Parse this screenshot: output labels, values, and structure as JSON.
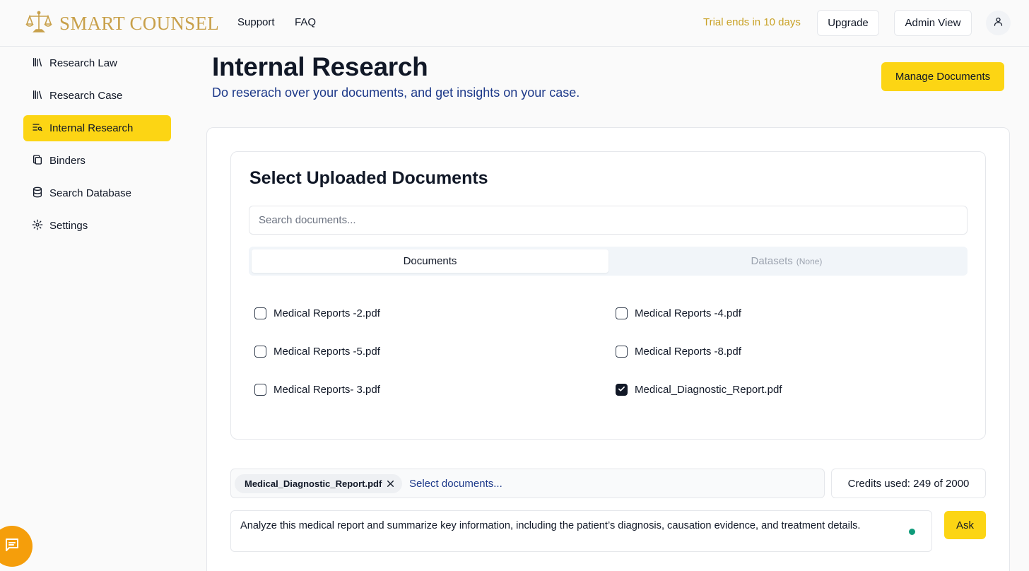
{
  "brand": {
    "name": "SMART COUNSEL",
    "logo_icon": "scales-of-justice-icon",
    "color": "#c8a04a"
  },
  "topnav": {
    "links": [
      "Support",
      "FAQ"
    ],
    "trial_text": "Trial ends in 10 days",
    "upgrade_label": "Upgrade",
    "admin_view_label": "Admin View",
    "user_icon": "user-icon"
  },
  "sidebar": {
    "items": [
      {
        "label": "Research Law",
        "icon": "library-icon",
        "active": false
      },
      {
        "label": "Research Case",
        "icon": "library-icon",
        "active": false
      },
      {
        "label": "Internal Research",
        "icon": "text-search-icon",
        "active": true
      },
      {
        "label": "Binders",
        "icon": "copy-icon",
        "active": false
      },
      {
        "label": "Search Database",
        "icon": "database-icon",
        "active": false
      },
      {
        "label": "Settings",
        "icon": "gear-icon",
        "active": false
      }
    ]
  },
  "header": {
    "title": "Internal Research",
    "subtitle": "Do reserach over your documents, and get insights on your case.",
    "manage_label": "Manage Documents"
  },
  "documents_panel": {
    "title": "Select Uploaded Documents",
    "search_placeholder": "Search documents...",
    "tabs": [
      {
        "label": "Documents",
        "note": "",
        "active": true
      },
      {
        "label": "Datasets",
        "note": "(None)",
        "active": false
      }
    ],
    "items": [
      {
        "name": "Medical Reports -2.pdf",
        "checked": false
      },
      {
        "name": "Medical Reports -4.pdf",
        "checked": false
      },
      {
        "name": "Medical Reports -5.pdf",
        "checked": false
      },
      {
        "name": "Medical Reports -8.pdf",
        "checked": false
      },
      {
        "name": "Medical Reports- 3.pdf",
        "checked": false
      },
      {
        "name": "Medical_Diagnostic_Report.pdf",
        "checked": true
      }
    ]
  },
  "query": {
    "selected_chip": "Medical_Diagnostic_Report.pdf",
    "selector_placeholder": "Select documents...",
    "credits": "Credits used: 249 of 2000",
    "question": "Analyze this medical report and summarize key information, including the patient’s diagnosis, causation evidence, and treatment details.",
    "ask_label": "Ask"
  },
  "colors": {
    "accent": "#fcd514",
    "subtitle": "#1e3a8a",
    "trial": "#c9a227",
    "chat_fab": "#f59e0b",
    "status_dot": "#0f9b7a"
  },
  "chat_fab_icon": "chat-message-icon"
}
